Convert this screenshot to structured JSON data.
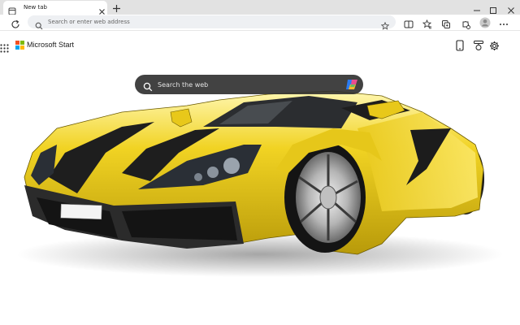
{
  "tab": {
    "title": "New tab",
    "favicon": "page-icon",
    "close_icon": "close-icon"
  },
  "new_tab_icon": "plus-icon",
  "window_controls": [
    "minimize-icon",
    "maximize-icon",
    "close-icon"
  ],
  "toolbar": {
    "refresh_icon": "refresh-icon",
    "address_placeholder": "Search or enter web address",
    "favorite_icon": "star-icon",
    "right_icons": [
      "split-screen-icon",
      "favorites-icon",
      "collections-icon",
      "extensions-icon",
      "profile-avatar",
      "more-icon"
    ]
  },
  "start": {
    "apps_icon": "apps-grid-icon",
    "brand": "Microsoft Start",
    "header_icons": [
      "mobile-app-icon",
      "rewards-icon",
      "settings-icon"
    ],
    "search_placeholder": "Search the web",
    "copilot_icon": "copilot-icon"
  },
  "colors": {
    "tab_strip": "#e2e2e2",
    "search_box": "#2d2d2d",
    "car_body": "#f0d21e",
    "car_stripes": "#222222",
    "ms_logo": [
      "#f25022",
      "#7fba00",
      "#00a4ef",
      "#ffb900"
    ]
  }
}
